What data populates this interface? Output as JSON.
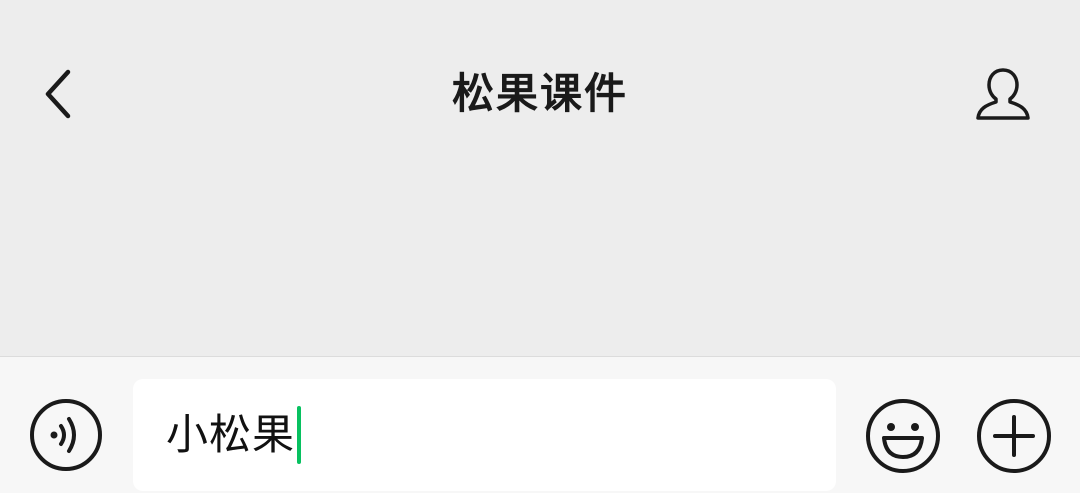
{
  "header": {
    "title": "松果课件",
    "back_icon": "chevron-left-icon",
    "profile_icon": "person-icon"
  },
  "input_bar": {
    "voice_icon": "voice-icon",
    "message_value": "小松果",
    "emoji_icon": "smiley-icon",
    "more_icon": "plus-circle-icon"
  },
  "colors": {
    "background": "#ededed",
    "input_bar_background": "#f7f7f7",
    "caret": "#07c160",
    "icon": "#1a1a1a"
  }
}
